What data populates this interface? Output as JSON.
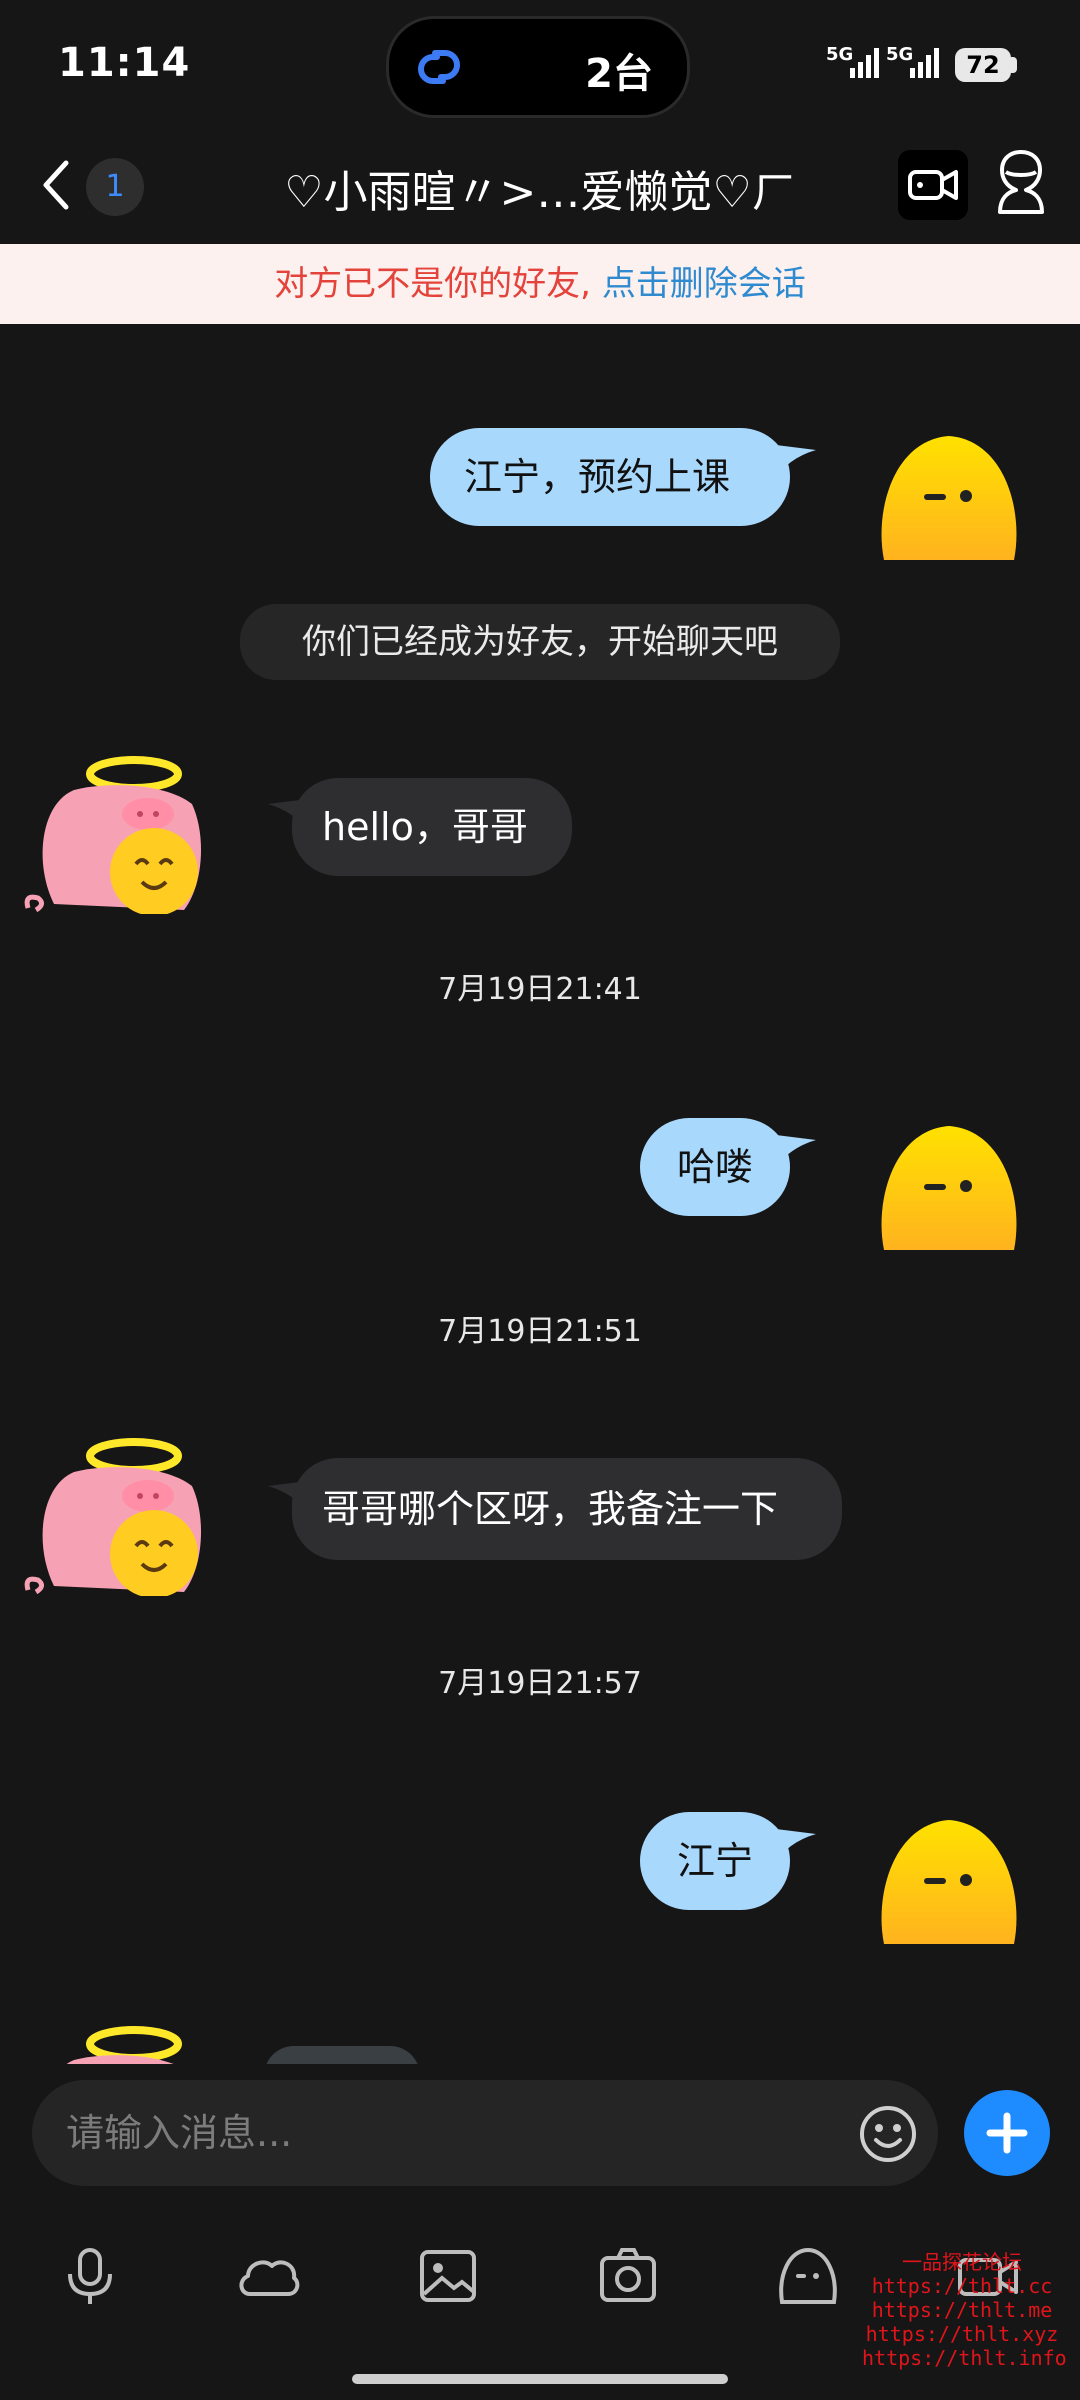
{
  "status_bar": {
    "time": "11:14",
    "island_text": "2台",
    "network_1": "5G",
    "network_2": "5G",
    "battery": "72"
  },
  "header": {
    "unread_count": "1",
    "title": "♡小雨暄〃>…爱懒觉♡ㄏ"
  },
  "notice": {
    "text": "对方已不是你的好友,",
    "link": "点击删除会话"
  },
  "messages": [
    {
      "type": "out",
      "text": "江宁，预约上课"
    },
    {
      "type": "system",
      "text": "你们已经成为好友，开始聊天吧"
    },
    {
      "type": "in",
      "text": "hello，哥哥"
    },
    {
      "type": "time",
      "text": "7月19日21:41"
    },
    {
      "type": "out",
      "text": "哈喽"
    },
    {
      "type": "time",
      "text": "7月19日21:51"
    },
    {
      "type": "in",
      "text": "哥哥哪个区呀，我备注一下"
    },
    {
      "type": "time",
      "text": "7月19日21:57"
    },
    {
      "type": "out",
      "text": "江宁"
    }
  ],
  "input": {
    "placeholder": "请输入消息..."
  },
  "toolbar": [
    "microphone-icon",
    "cloud-icon",
    "image-icon",
    "camera-icon",
    "sticker-icon",
    "video-icon"
  ],
  "watermark": [
    "一品探花论坛",
    "https://thlt.cc",
    "https://thlt.me",
    "https://thlt.xyz",
    "https://thlt.info"
  ],
  "colors": {
    "background": "#161616",
    "outgoing_bubble": "#a9d8fd",
    "incoming_bubble": "#2e2e30",
    "accent": "#1e8bff",
    "notice_red": "#e3433b",
    "notice_link": "#2f8ad0"
  }
}
